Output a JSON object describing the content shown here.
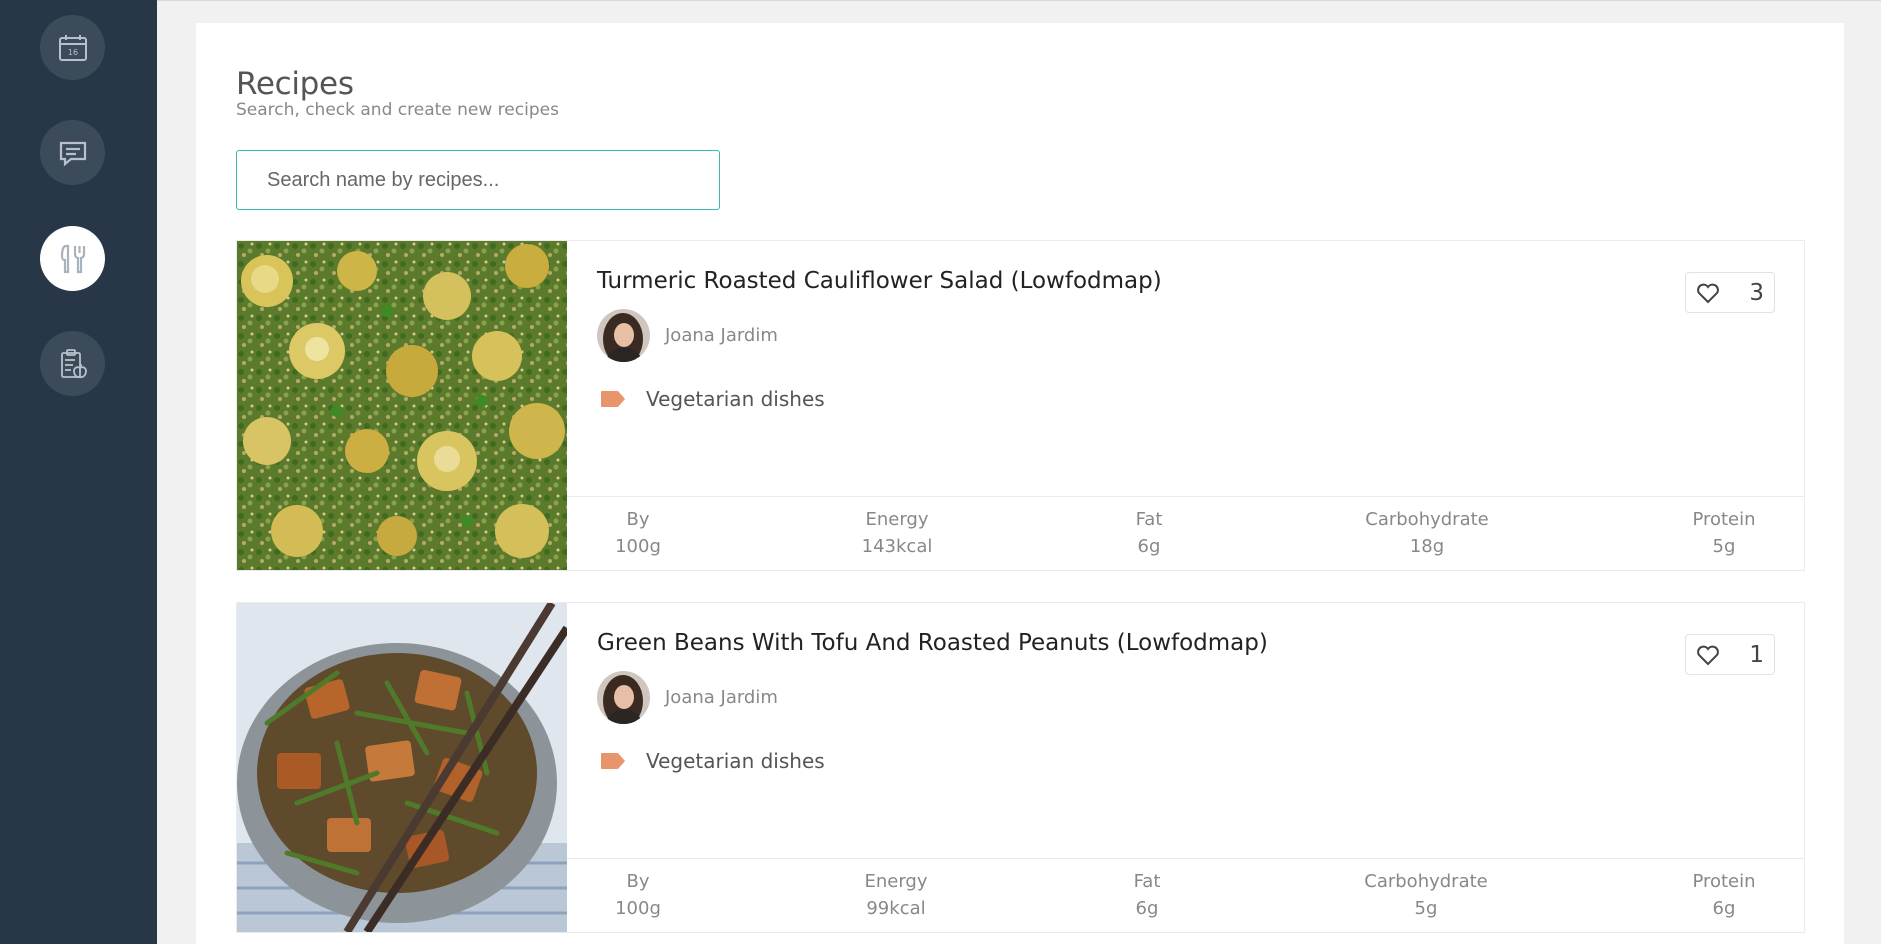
{
  "page": {
    "title": "Recipes",
    "subtitle": "Search, check and create new recipes"
  },
  "search": {
    "placeholder": "Search name by recipes...",
    "value": ""
  },
  "sidebar": {
    "items": [
      {
        "name": "calendar",
        "icon": "calendar-icon",
        "active": false
      },
      {
        "name": "messages",
        "icon": "chat-icon",
        "active": false
      },
      {
        "name": "recipes",
        "icon": "utensils-icon",
        "active": true
      },
      {
        "name": "meal-plans",
        "icon": "clipboard-apple-icon",
        "active": false
      }
    ]
  },
  "recipes": [
    {
      "title": "Turmeric Roasted Cauliflower Salad (Lowfodmap)",
      "author": "Joana Jardim",
      "category": "Vegetarian dishes",
      "likes": "3",
      "nutrition": [
        {
          "label": "By",
          "value": "100g"
        },
        {
          "label": "Energy",
          "value": "143kcal"
        },
        {
          "label": "Fat",
          "value": "6g"
        },
        {
          "label": "Carbohydrate",
          "value": "18g"
        },
        {
          "label": "Protein",
          "value": "5g"
        }
      ]
    },
    {
      "title": "Green Beans With Tofu And Roasted Peanuts (Lowfodmap)",
      "author": "Joana Jardim",
      "category": "Vegetarian dishes",
      "likes": "1",
      "nutrition": [
        {
          "label": "By",
          "value": "100g"
        },
        {
          "label": "Energy",
          "value": "99kcal"
        },
        {
          "label": "Fat",
          "value": "6g"
        },
        {
          "label": "Carbohydrate",
          "value": "5g"
        },
        {
          "label": "Protein",
          "value": "6g"
        }
      ]
    }
  ],
  "colors": {
    "sidebar": "#283747",
    "accent": "#3bb7a5",
    "tag": "#e8956b"
  }
}
